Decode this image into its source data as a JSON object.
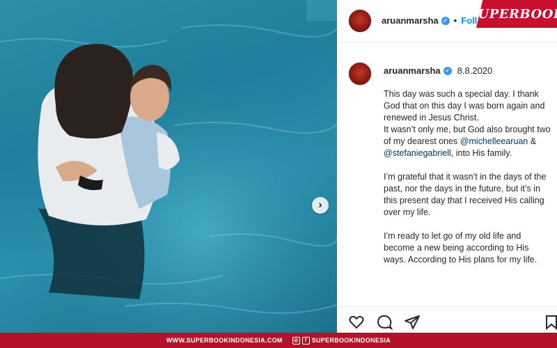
{
  "header": {
    "username": "aruanmarsha",
    "dot": "•",
    "follow_label": "Foll"
  },
  "brand": {
    "name": "SUPERBOOK"
  },
  "post": {
    "username": "aruanmarsha",
    "date": "8.8.2020",
    "caption": {
      "p1_line1": "This day was such a special day. I thank God that on this day I was born again and renewed in Jesus Christ.",
      "p1_line2": "It wasn’t only me, but God also brought two of my dearest ones",
      "mention1": "@michelleearuan",
      "amp": " & ",
      "mention2": "@stefaniegabriell",
      "p1_tail": ", into His family.",
      "p2": "I’m grateful that it wasn’t in the days of the past, nor the days in the future, but it’s in this present day that I received His calling over my life.",
      "p3": "I’m ready to let go of my old life and become a new being according to His ways. According to His plans for my life."
    }
  },
  "icons": {
    "verified": "verified-badge-icon",
    "like": "heart-icon",
    "comment": "comment-icon",
    "share": "paper-plane-icon",
    "save": "bookmark-icon",
    "next": "chevron-right-icon"
  },
  "footer": {
    "website": "WWW.SUPERBOOKINDONESIA.COM",
    "social_handle": "SUPERBOOKINDONESIA"
  },
  "colors": {
    "brand_red": "#c8102e",
    "footer_red": "#b3122a",
    "verified_blue": "#3897f0",
    "link_blue": "#0095f6",
    "mention_blue": "#00376b",
    "water": "#2a91ad"
  }
}
